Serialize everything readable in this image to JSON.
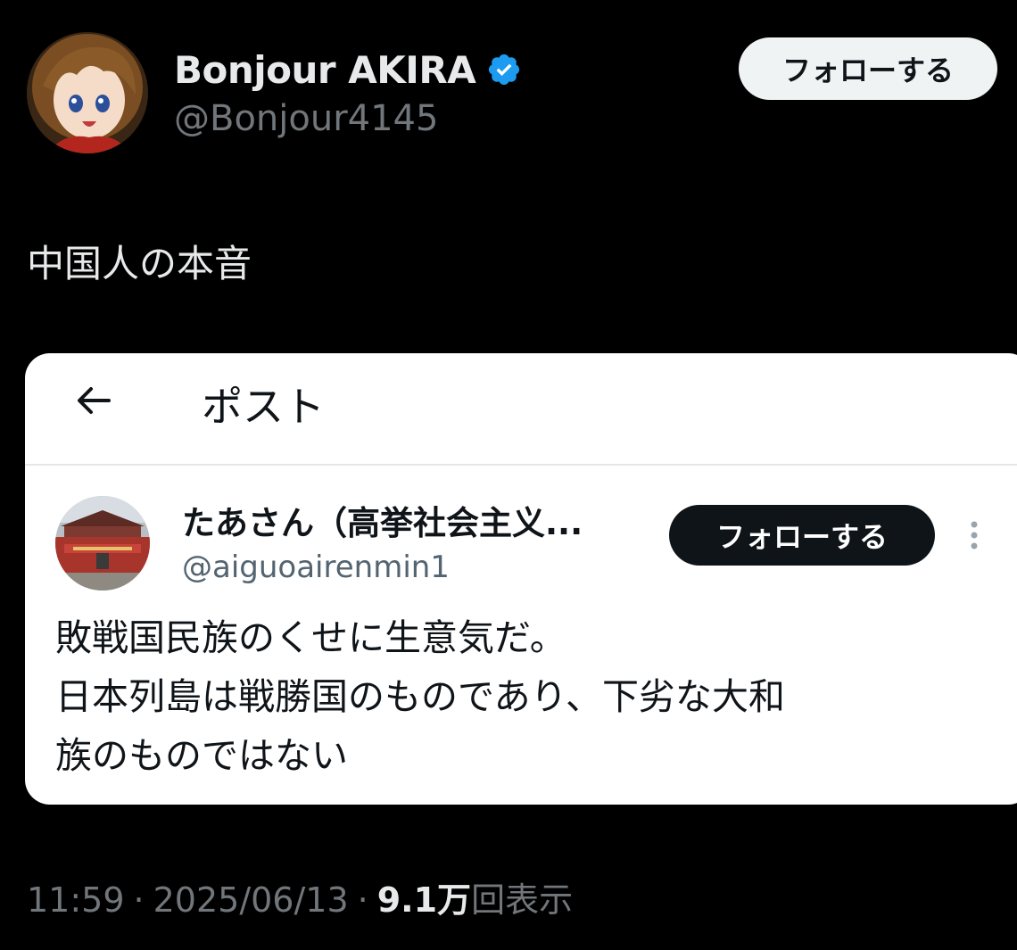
{
  "author": {
    "display_name": "Bonjour AKIRA",
    "handle": "@Bonjour4145",
    "avatar_icon": "anime-character-avatar",
    "verified_icon": "verified-badge-icon",
    "verified_color": "#1d9bf0"
  },
  "follow_button": {
    "label": "フォローする"
  },
  "tweet": {
    "text": "中国人の本音"
  },
  "embedded_screenshot": {
    "header_title": "ポスト",
    "back_icon": "back-arrow-icon",
    "quoted_user": {
      "display_name": "たあさん（高挙社会主义...",
      "handle": "@aiguoairenmin1",
      "avatar_icon": "tiananmen-gate-avatar",
      "follow_label": "フォローする",
      "more_icon": "more-vertical-icon"
    },
    "body_lines": [
      "敗戦国民族のくせに生意気だ。",
      "日本列島は戦勝国のものであり、下劣な大和",
      "族のものではない"
    ]
  },
  "meta": {
    "time": "11:59",
    "separator": "·",
    "date": "2025/06/13",
    "views_count": "9.1万",
    "views_label": "回表示"
  },
  "colors": {
    "background": "#000000",
    "primary_text": "#e7e9ea",
    "secondary_text": "#71767b",
    "accent_blue": "#1d9bf0"
  }
}
